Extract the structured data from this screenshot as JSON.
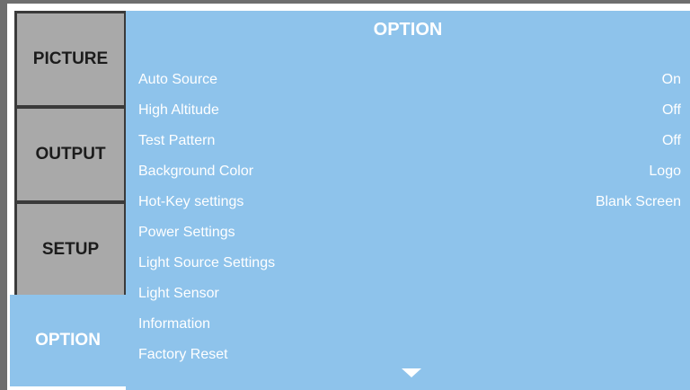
{
  "tabs": [
    {
      "label": "PICTURE",
      "active": false
    },
    {
      "label": "OUTPUT",
      "active": false
    },
    {
      "label": "SETUP",
      "active": false
    },
    {
      "label": "OPTION",
      "active": true
    }
  ],
  "panel": {
    "title": "OPTION",
    "items": [
      {
        "label": "Auto Source",
        "value": "On"
      },
      {
        "label": "High Altitude",
        "value": "Off"
      },
      {
        "label": "Test Pattern",
        "value": "Off"
      },
      {
        "label": "Background Color",
        "value": "Logo"
      },
      {
        "label": "Hot-Key settings",
        "value": "Blank Screen"
      },
      {
        "label": "Power Settings",
        "value": ""
      },
      {
        "label": "Light Source Settings",
        "value": ""
      },
      {
        "label": "Light Sensor",
        "value": ""
      },
      {
        "label": "Information",
        "value": ""
      },
      {
        "label": "Factory Reset",
        "value": ""
      }
    ],
    "scroll_indicator_icon": "down-triangle-icon"
  },
  "colors": {
    "panel_bg": "#8ec3eb",
    "active_tab_bg": "#8ec3eb",
    "inactive_tab_bg": "#a9a9a9",
    "frame": "#6e6e6e",
    "text_light": "#ffffff",
    "text_dark": "#1c1c1c"
  }
}
